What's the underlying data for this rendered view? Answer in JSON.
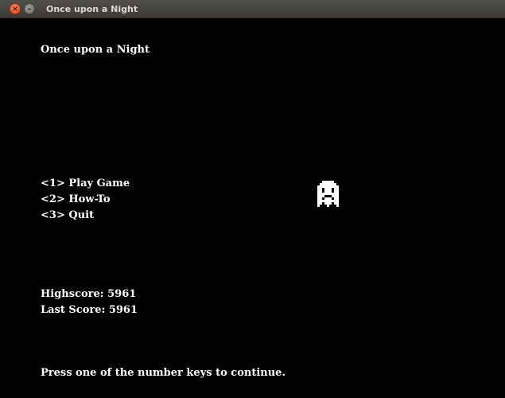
{
  "window": {
    "title": "Once upon a Night",
    "close_glyph": "×",
    "minimize_glyph": "–"
  },
  "game": {
    "heading": "Once upon a Night",
    "menu": [
      {
        "label": "<1> Play Game"
      },
      {
        "label": "<2> How-To"
      },
      {
        "label": "<3> Quit"
      }
    ],
    "highscore_text": "Highscore: 5961",
    "last_score_text": "Last Score: 5961",
    "prompt": "Press one of the number keys to continue."
  },
  "icons": {
    "ghost": "ghost-sprite-icon"
  },
  "colors": {
    "background": "#000000",
    "text": "#ffffff",
    "titlebar": "#3c3b37",
    "close_button": "#df4a16"
  }
}
